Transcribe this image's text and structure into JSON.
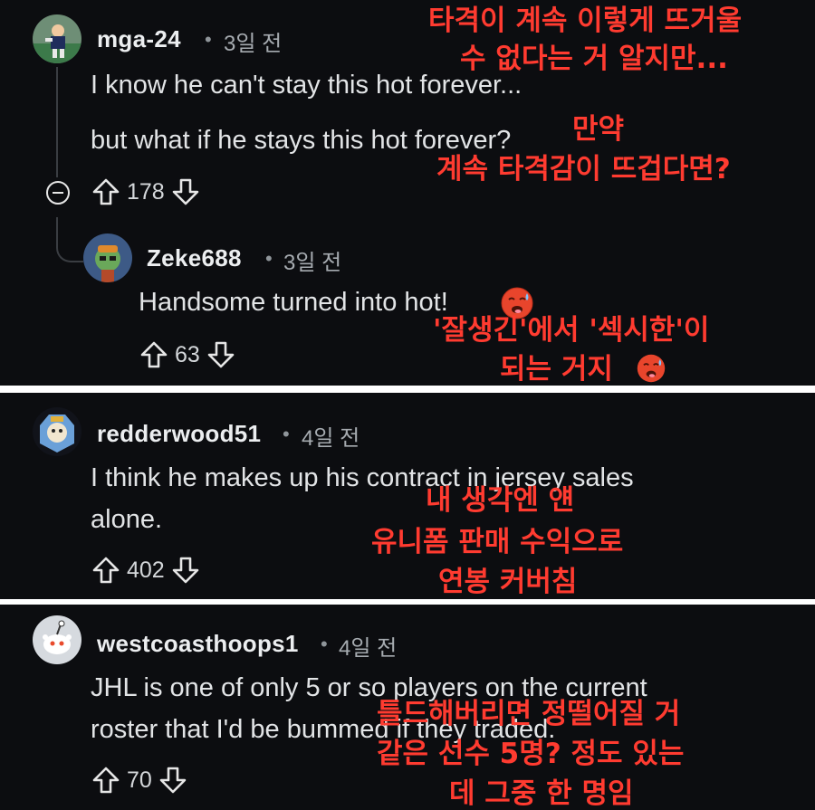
{
  "comments": [
    {
      "username": "mga-24",
      "time": "3일 전",
      "lines": [
        "I know he can't stay this hot forever...",
        "but what if he stays this hot forever?"
      ],
      "votes": "178",
      "reply": {
        "username": "Zeke688",
        "time": "3일 전",
        "lines": [
          "Handsome turned into hot!"
        ],
        "votes": "63"
      }
    },
    {
      "username": "redderwood51",
      "time": "4일 전",
      "lines": [
        "I think he makes up his contract in jersey sales",
        "alone."
      ],
      "votes": "402"
    },
    {
      "username": "westcoasthoops1",
      "time": "4일 전",
      "lines": [
        "JHL is one of only 5 or so players on the current",
        "roster that I'd be bummed if they traded."
      ],
      "votes": "70"
    }
  ],
  "overlays": {
    "t1": [
      "타격이 계속 이렇게 뜨거울",
      "수 없다는 거 알지만..."
    ],
    "t2": [
      "만약",
      "계속 타격감이 뜨겁다면?"
    ],
    "t3": [
      "'잘생긴'에서 '섹시한'이",
      "되는 거지"
    ],
    "t4": [
      "내 생각엔 얜",
      "유니폼 판매 수익으로",
      "연봉 커버침"
    ],
    "t5": [
      "틀드해버리면 정떨어질 거",
      "같은 선수 5명? 정도 있는",
      "데 그중 한 명임"
    ]
  },
  "dot": "•",
  "colors": {
    "background": "#0c0d10",
    "overlay_text": "#ff3b30",
    "username": "#eceef0",
    "meta": "#a6abb0"
  },
  "icons": [
    "upvote-icon",
    "downvote-icon",
    "collapse-icon",
    "hot-face-emoji"
  ]
}
